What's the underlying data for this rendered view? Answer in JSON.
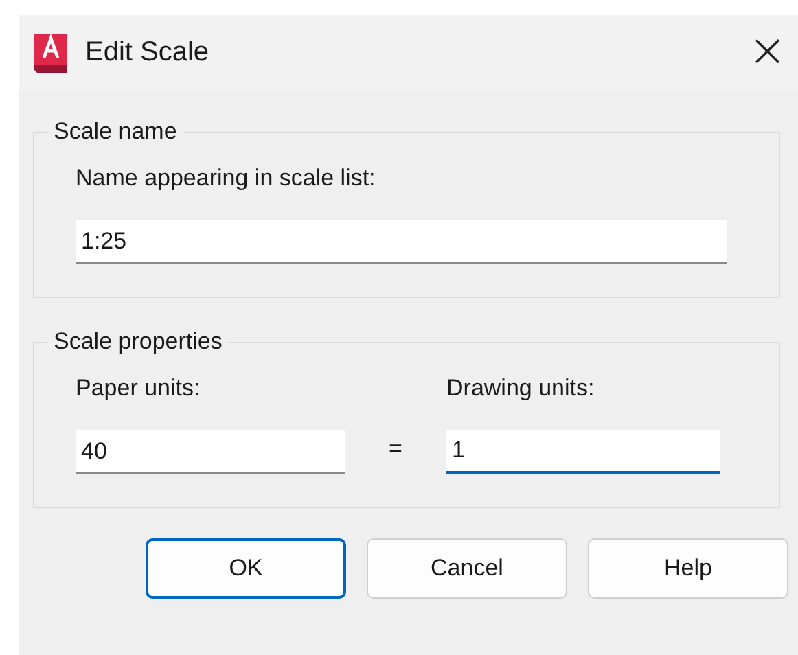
{
  "window": {
    "title": "Edit Scale",
    "close": "×"
  },
  "scale_name": {
    "legend": "Scale name",
    "label": "Name appearing in scale list:",
    "value": "1:25"
  },
  "scale_properties": {
    "legend": "Scale properties",
    "separator": "=",
    "fields": [
      {
        "label": "Paper units:",
        "value": "40",
        "focused": false
      },
      {
        "label": "Drawing units:",
        "value": "1",
        "focused": true
      }
    ]
  },
  "buttons": [
    {
      "label": "OK",
      "default": true
    },
    {
      "label": "Cancel",
      "default": false
    },
    {
      "label": "Help",
      "default": false
    }
  ]
}
